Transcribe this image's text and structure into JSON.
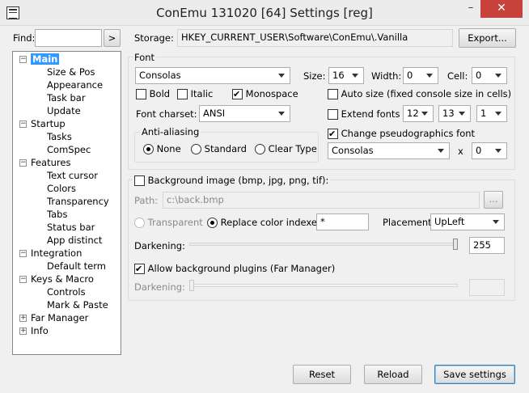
{
  "window": {
    "title": "ConEmu 131020 [64] Settings [reg]",
    "minimize": "–",
    "close": "✕"
  },
  "find": {
    "label": "Find:",
    "value": "",
    "go": ">"
  },
  "storage": {
    "label": "Storage:",
    "value": "HKEY_CURRENT_USER\\Software\\ConEmu\\.Vanilla",
    "export": "Export..."
  },
  "tree": {
    "main": "Main",
    "size_pos": "Size & Pos",
    "appearance": "Appearance",
    "task_bar": "Task bar",
    "update": "Update",
    "startup": "Startup",
    "tasks": "Tasks",
    "comspec": "ComSpec",
    "features": "Features",
    "text_cursor": "Text cursor",
    "colors": "Colors",
    "transparency": "Transparency",
    "tabs": "Tabs",
    "status_bar": "Status bar",
    "app_distinct": "App distinct",
    "integration": "Integration",
    "default_term": "Default term",
    "keys_macro": "Keys & Macro",
    "controls": "Controls",
    "mark_paste": "Mark & Paste",
    "far_manager": "Far Manager",
    "info": "Info",
    "minus": "−",
    "plus": "+"
  },
  "font": {
    "group": "Font",
    "face": "Consolas",
    "size_label": "Size:",
    "size": "16",
    "width_label": "Width:",
    "width": "0",
    "cell_label": "Cell:",
    "cell": "0",
    "bold": "Bold",
    "italic": "Italic",
    "monospace": "Monospace",
    "autosize": "Auto size (fixed console size in cells)",
    "extend": "Extend fonts",
    "ext1": "12",
    "ext2": "13",
    "ext3": "1",
    "charset_label": "Font charset:",
    "charset": "ANSI",
    "aa_group": "Anti-aliasing",
    "aa_none": "None",
    "aa_standard": "Standard",
    "aa_cleartype": "Clear Type",
    "pseudo": "Change pseudographics font",
    "pseudo_face": "Consolas",
    "x": "x",
    "pseudo_size": "0"
  },
  "bg": {
    "title": "Background image (bmp, jpg, png, tif):",
    "path_label": "Path:",
    "path": "c:\\back.bmp",
    "browse": "...",
    "transparent": "Transparent",
    "replace": "Replace color indexes",
    "replace_value": "*",
    "placement_label": "Placement:",
    "placement": "UpLeft",
    "darkening_label": "Darkening:",
    "darkening": "255",
    "darkening_level": 1.0,
    "allow_plugins": "Allow background plugins (Far Manager)",
    "darkening2_label": "Darkening:",
    "darkening2_value": "",
    "darkening2_level": 0.0
  },
  "footer": {
    "reset": "Reset",
    "reload": "Reload",
    "save": "Save settings"
  }
}
